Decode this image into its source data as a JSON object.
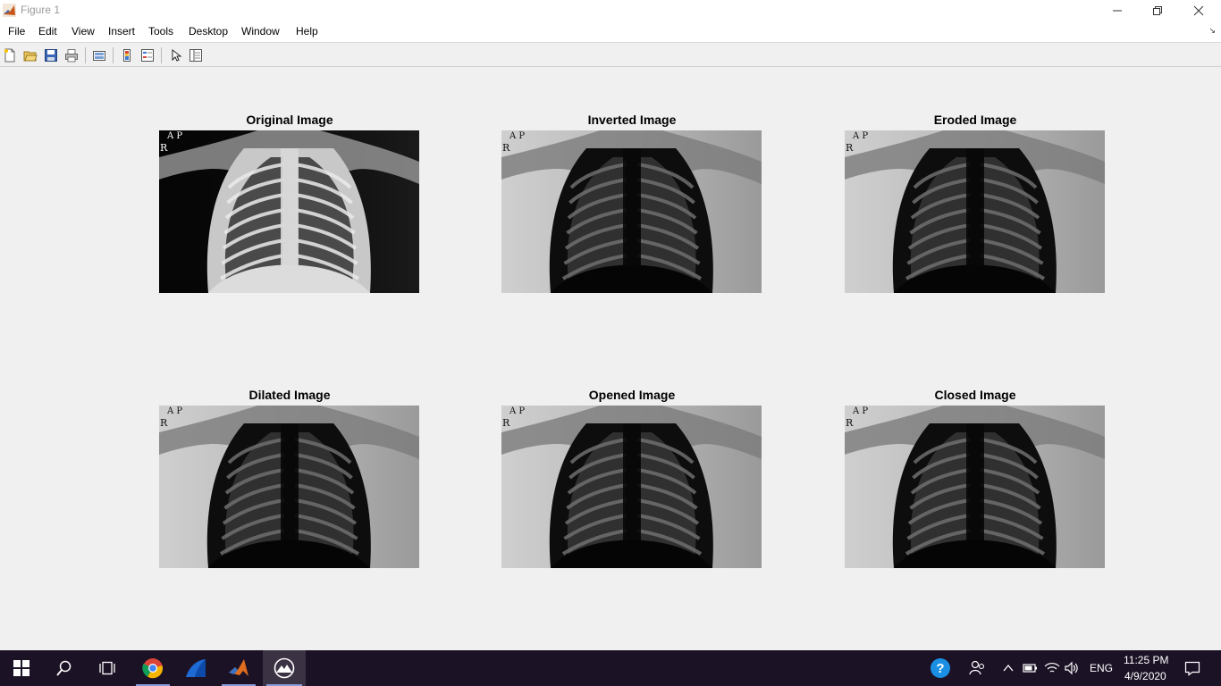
{
  "window": {
    "title": "Figure 1"
  },
  "menubar": {
    "items": [
      "File",
      "Edit",
      "View",
      "Insert",
      "Tools",
      "Desktop",
      "Window",
      "Help"
    ]
  },
  "toolbar": {
    "icons": [
      "new-figure-icon",
      "open-file-icon",
      "save-icon",
      "print-icon",
      "link-plot-icon",
      "colorbar-icon",
      "legend-icon",
      "edit-plot-icon",
      "property-inspector-icon"
    ]
  },
  "figure": {
    "subplots": [
      {
        "title": "Original Image",
        "variant": "original"
      },
      {
        "title": "Inverted Image",
        "variant": "inverted"
      },
      {
        "title": "Eroded Image",
        "variant": "eroded"
      },
      {
        "title": "Dilated Image",
        "variant": "dilated"
      },
      {
        "title": "Opened Image",
        "variant": "opened"
      },
      {
        "title": "Closed Image",
        "variant": "closed"
      }
    ],
    "image_markers": {
      "top": "A  P",
      "left": "R"
    }
  },
  "taskbar": {
    "apps": [
      "start-icon",
      "search-icon",
      "task-view-icon",
      "chrome-icon",
      "app-icon",
      "matlab-icon",
      "figure-app-icon"
    ],
    "language": "ENG",
    "time": "11:25 PM",
    "date": "4/9/2020"
  }
}
